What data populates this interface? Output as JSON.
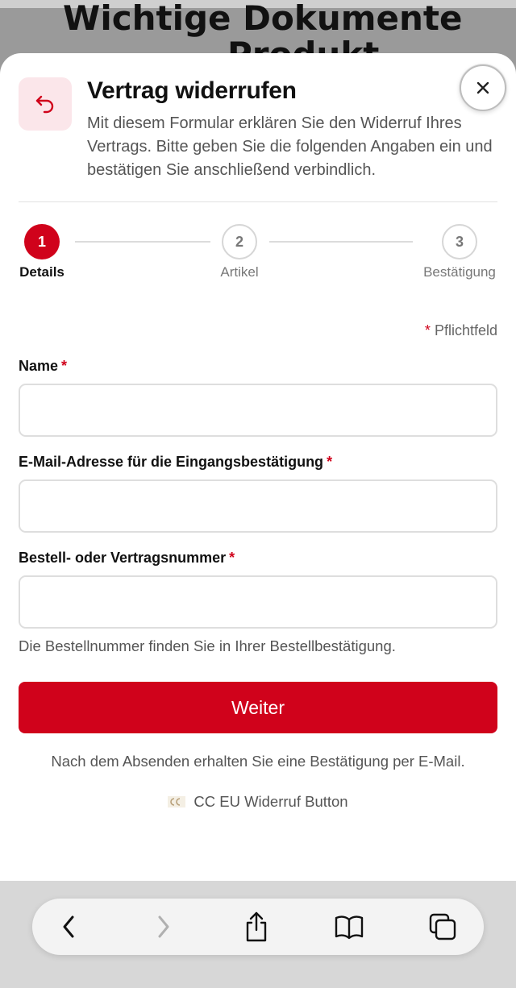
{
  "background": {
    "page_title": "Wichtige Dokumente",
    "page_title_line2": "Produkt"
  },
  "dialog": {
    "title": "Vertrag widerrufen",
    "description": "Mit diesem Formular erklären Sie den Widerruf Ihres Vertrags. Bitte geben Sie die folgenden Angaben ein und bestätigen Sie anschließend verbindlich.",
    "header_icon": "undo-arrow-icon",
    "close_icon": "close-icon",
    "steps": [
      {
        "number": "1",
        "label": "Details",
        "active": true
      },
      {
        "number": "2",
        "label": "Artikel",
        "active": false
      },
      {
        "number": "3",
        "label": "Bestätigung",
        "active": false
      }
    ],
    "required_note_star": "*",
    "required_note": "Pflichtfeld",
    "fields": [
      {
        "label": "Name",
        "required": "*",
        "value": "",
        "placeholder": ""
      },
      {
        "label": "E-Mail-Adresse für die Eingangsbestätigung",
        "required": "*",
        "value": "",
        "placeholder": ""
      },
      {
        "label": "Bestell- oder Vertragsnummer",
        "required": "*",
        "value": "",
        "placeholder": ""
      }
    ],
    "order_hint": "Die Bestellnummer finden Sie in Ihrer Bestellbestätigung.",
    "submit_label": "Weiter",
    "footer_note": "Nach dem Absenden erhalten Sie eine Bestätigung per E-Mail.",
    "brand_label": "CC EU Widerruf Button"
  },
  "browser_toolbar": {
    "icons": [
      "back-icon",
      "forward-icon",
      "share-icon",
      "bookmarks-icon",
      "tabs-icon"
    ]
  },
  "colors": {
    "accent": "#d0021b",
    "icon_bg": "#fbe6ea"
  }
}
